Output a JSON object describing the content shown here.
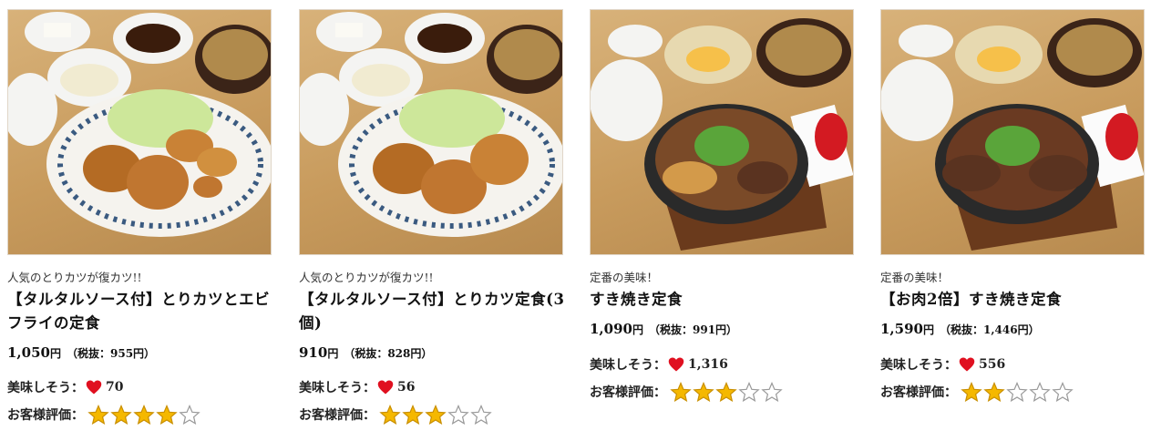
{
  "labels": {
    "likes_prefix": "美味しそう：",
    "rating_prefix": "お客様評価："
  },
  "colors": {
    "heart": "#e01020",
    "star_filled": "#f5b800",
    "star_outline": "#999999"
  },
  "products": [
    {
      "tagline": "人気のとりカツが復カツ!!",
      "title": "【タルタルソース付】とりカツとエビフライの定食",
      "price": "1,050",
      "price_unit": "円",
      "tax_note": "（税抜：955円）",
      "likes": "70",
      "rating": 4,
      "rating_max": 5
    },
    {
      "tagline": "人気のとりカツが復カツ!!",
      "title": "【タルタルソース付】とりカツ定食(3個)",
      "price": "910",
      "price_unit": "円",
      "tax_note": "（税抜：828円）",
      "likes": "56",
      "rating": 3,
      "rating_max": 5
    },
    {
      "tagline": "定番の美味！",
      "title": "すき焼き定食",
      "price": "1,090",
      "price_unit": "円",
      "tax_note": "（税抜：991円）",
      "likes": "1,316",
      "rating": 3,
      "rating_max": 5
    },
    {
      "tagline": "定番の美味！",
      "title": "【お肉2倍】すき焼き定食",
      "price": "1,590",
      "price_unit": "円",
      "tax_note": "（税抜：1,446円）",
      "likes": "556",
      "rating": 2,
      "rating_max": 5
    }
  ]
}
